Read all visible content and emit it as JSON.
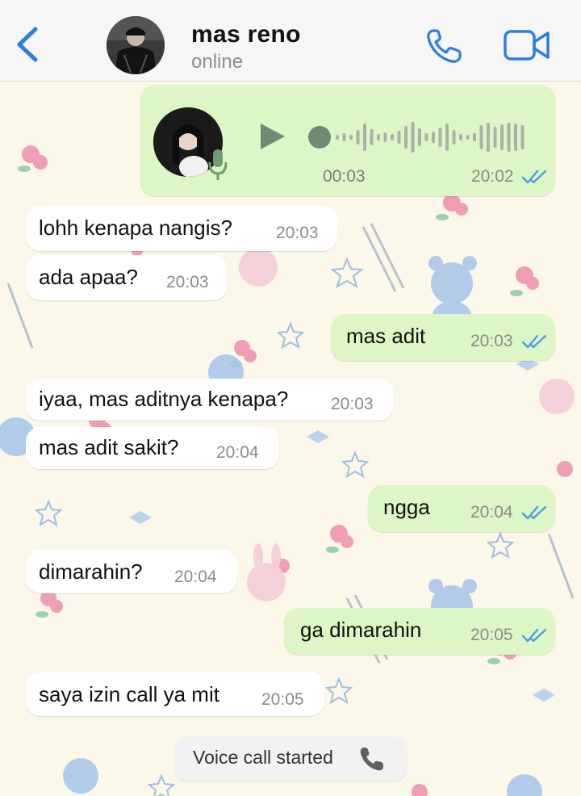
{
  "header": {
    "contact_name": "mas reno",
    "status": "online",
    "icons": [
      "chevron-left-icon",
      "phone-icon",
      "video-camera-icon"
    ],
    "accent_color": "#2b7fe0"
  },
  "voice_message": {
    "duration": "00:03",
    "time": "20:02",
    "read": true
  },
  "messages": [
    {
      "dir": "in",
      "text": "lohh kenapa nangis?",
      "time": "20:03"
    },
    {
      "dir": "in",
      "text": "ada apaa?",
      "time": "20:03"
    },
    {
      "dir": "out",
      "text": "mas adit",
      "time": "20:03",
      "read": true
    },
    {
      "dir": "in",
      "text": "iyaa, mas aditnya kenapa?",
      "time": "20:03"
    },
    {
      "dir": "in",
      "text": "mas adit sakit?",
      "time": "20:04"
    },
    {
      "dir": "out",
      "text": "ngga",
      "time": "20:04",
      "read": true
    },
    {
      "dir": "in",
      "text": "dimarahin?",
      "time": "20:04"
    },
    {
      "dir": "out",
      "text": "ga dimarahin",
      "time": "20:05",
      "read": true
    },
    {
      "dir": "in",
      "text": "saya izin call ya mit",
      "time": "20:05"
    }
  ],
  "system_message": {
    "text": "Voice call started",
    "icon": "phone-receiver-icon"
  },
  "colors": {
    "outgoing_bubble": "#dcf7c5",
    "incoming_bubble": "#ffffff",
    "read_ticks": "#4a9ee8"
  }
}
